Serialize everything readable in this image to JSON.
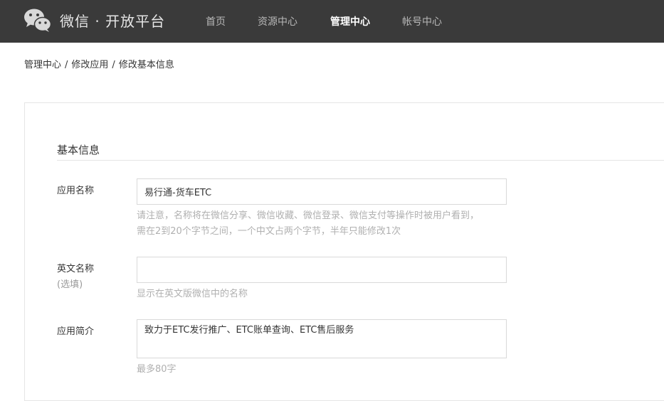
{
  "header": {
    "brand": "微信 · 开放平台",
    "logo_icon": "wechat-logo-icon",
    "nav": [
      {
        "label": "首页",
        "active": false
      },
      {
        "label": "资源中心",
        "active": false
      },
      {
        "label": "管理中心",
        "active": true
      },
      {
        "label": "帐号中心",
        "active": false
      }
    ]
  },
  "breadcrumb": {
    "items": [
      "管理中心",
      "修改应用",
      "修改基本信息"
    ],
    "separator": "/"
  },
  "form": {
    "section_title": "基本信息",
    "app_name": {
      "label": "应用名称",
      "value": "易行通-货车ETC",
      "hint_line1": "请注意，名称将在微信分享、微信收藏、微信登录、微信支付等操作时被用户看到，",
      "hint_line2": "需在2到20个字节之间，一个中文占两个字节，半年只能修改1次"
    },
    "english_name": {
      "label": "英文名称",
      "optional": "(选填)",
      "value": "",
      "hint": "显示在英文版微信中的名称"
    },
    "app_intro": {
      "label": "应用简介",
      "value": "致力于ETC发行推广、ETC账单查询、ETC售后服务",
      "hint": "最多80字"
    }
  },
  "colors": {
    "topbar": "#3a3a3a",
    "hint": "#b0b0b0",
    "border": "#d9d9d9"
  }
}
